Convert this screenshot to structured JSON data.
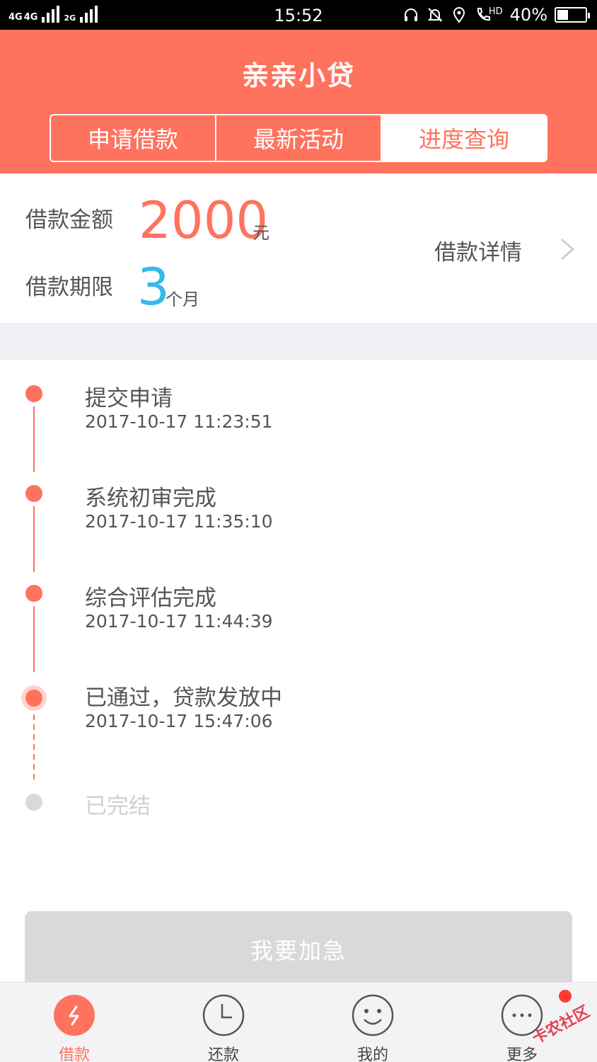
{
  "status_bar": {
    "network_1": "4G",
    "network_2": "4G",
    "network_3": "2G",
    "time": "15:52",
    "hd_label": "HD",
    "battery": "40%",
    "battery_level": 0.4
  },
  "header": {
    "title": "亲亲小贷",
    "tabs": [
      {
        "label": "申请借款",
        "active": false
      },
      {
        "label": "最新活动",
        "active": false
      },
      {
        "label": "进度查询",
        "active": true
      }
    ]
  },
  "loan": {
    "amount_label": "借款金额",
    "amount_value": "2000",
    "amount_unit": "元",
    "term_label": "借款期限",
    "term_value": "3",
    "term_unit": "个月",
    "detail_link": "借款详情"
  },
  "timeline": [
    {
      "title": "提交申请",
      "time": "2017-10-17 11:23:51",
      "state": "done"
    },
    {
      "title": "系统初审完成",
      "time": "2017-10-17 11:35:10",
      "state": "done"
    },
    {
      "title": "综合评估完成",
      "time": "2017-10-17 11:44:39",
      "state": "done"
    },
    {
      "title": "已通过，贷款发放中",
      "time": "2017-10-17 15:47:06",
      "state": "current"
    },
    {
      "title": "已完结",
      "time": "",
      "state": "pending"
    }
  ],
  "action_button": "我要加急",
  "bottom_nav": [
    {
      "label": "借款",
      "icon": "lightning-icon",
      "active": true
    },
    {
      "label": "还款",
      "icon": "clock-icon",
      "active": false
    },
    {
      "label": "我的",
      "icon": "smiley-icon",
      "active": false
    },
    {
      "label": "更多",
      "icon": "more-dots-icon",
      "active": false
    }
  ],
  "watermark": "卡农社区",
  "colors": {
    "accent": "#ff725e",
    "term_blue": "#35b8ea",
    "disabled": "#d9d9d9"
  }
}
